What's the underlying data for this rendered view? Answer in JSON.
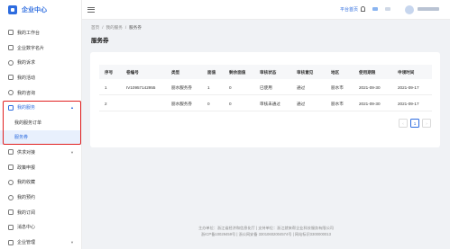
{
  "brand": {
    "name": "企业中心"
  },
  "nav": {
    "items_top": [
      {
        "label": "我的工作台",
        "name": "nav-item-workbench",
        "icon": "workbench-icon"
      },
      {
        "label": "企业数字名片",
        "name": "nav-item-digital-card",
        "icon": "id-card-icon"
      },
      {
        "label": "我的诉求",
        "name": "nav-item-demands",
        "icon": "message-icon"
      },
      {
        "label": "我的活动",
        "name": "nav-item-activities",
        "icon": "calendar-icon"
      },
      {
        "label": "我的咨询",
        "name": "nav-item-consulting",
        "icon": "chat-icon"
      }
    ],
    "service": {
      "label": "我的服务",
      "sub": [
        {
          "label": "我的服务订单"
        },
        {
          "label": "服务券"
        }
      ]
    },
    "items_bottom": [
      {
        "label": "供求对接",
        "name": "nav-item-supply-demand",
        "icon": "link-icon"
      },
      {
        "label": "政策申报",
        "name": "nav-item-policy",
        "icon": "document-icon"
      },
      {
        "label": "我的收藏",
        "name": "nav-item-favorites",
        "icon": "star-icon"
      },
      {
        "label": "我的预约",
        "name": "nav-item-appointments",
        "icon": "clock-icon"
      },
      {
        "label": "我的订阅",
        "name": "nav-item-subscriptions",
        "icon": "rss-icon"
      },
      {
        "label": "消息中心",
        "name": "nav-item-messages",
        "icon": "mail-icon"
      },
      {
        "label": "企业管理",
        "name": "nav-item-enterprise",
        "icon": "building-icon"
      }
    ]
  },
  "header": {
    "platform_link": "平台首页"
  },
  "breadcrumb": [
    "首页",
    "我的服务",
    "服务券"
  ],
  "page_title": "服务券",
  "table": {
    "columns": [
      "序号",
      "卷编号",
      "类型",
      "面值",
      "剩余面值",
      "审核状态",
      "审核意见",
      "地区",
      "使用期限",
      "申领时间"
    ],
    "rows": [
      [
        "1",
        "IV10957142955",
        "丽水服务券",
        "1",
        "0",
        "已使用",
        "通过",
        "丽水市",
        "2021-09-30",
        "2021-09-17"
      ],
      [
        "2",
        "",
        "丽水服务券",
        "0",
        "0",
        "审核未通过",
        "通过",
        "丽水市",
        "2021-09-30",
        "2021-09-17"
      ]
    ]
  },
  "pagination": {
    "prev": "‹",
    "current": "1",
    "next": "›"
  },
  "footer": {
    "line1": "主办单位：浙江省经济和信息化厅 | 支持单位：浙江就来帮企业科技服务有限公司",
    "line2": "浙ICP备10029459号 | 浙公网安备 33010602004574号 | 网站标识3300000013"
  },
  "colors": {
    "accent": "#2d6cdf",
    "highlight_box": "#e02020",
    "active_bg": "#e8f0fd"
  }
}
